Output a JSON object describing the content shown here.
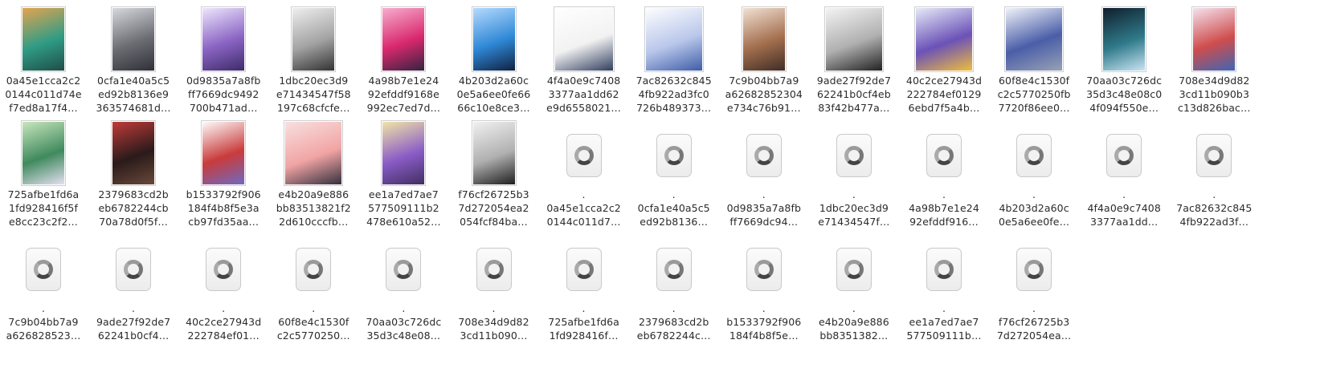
{
  "files": [
    {
      "kind": "image",
      "label": "0a45e1cca2c2\n0144c011d74e\nf7ed8a17f4…",
      "colors": [
        "#e8a44e",
        "#2f9c85",
        "#1f4a46"
      ]
    },
    {
      "kind": "image",
      "label": "0cfa1e40a5c5\ned92b8136e9\n363574681d…",
      "colors": [
        "#d8dbe0",
        "#6c6c73",
        "#2e2e36"
      ]
    },
    {
      "kind": "image",
      "label": "0d9835a7a8fb\nff7669dc9492\n700b471ad…",
      "colors": [
        "#efe9ff",
        "#8b64c4",
        "#3a2a66"
      ]
    },
    {
      "kind": "image",
      "label": "1dbc20ec3d9\ne71434547f58\n197c68cfcfe…",
      "colors": [
        "#f0f0f0",
        "#a3a3a3",
        "#2f2f2f"
      ]
    },
    {
      "kind": "image",
      "label": "4a98b7e1e24\n92efddf9168e\n992ec7ed7d…",
      "colors": [
        "#f7b1d1",
        "#d9286d",
        "#2f2340"
      ]
    },
    {
      "kind": "image",
      "label": "4b203d2a60c\n0e5a6ee0fe66\n66c10e8ce3…",
      "colors": [
        "#b9dcff",
        "#2f88d6",
        "#0e1e3c"
      ]
    },
    {
      "kind": "image-square",
      "label": "4f4a0e9c7408\n3377aa1dd62\ne9d6558021…",
      "colors": [
        "#ffffff",
        "#f2f2f2",
        "#2b3a5b"
      ]
    },
    {
      "kind": "image-wide",
      "label": "7ac82632c845\n4fb922ad3fc0\n726b489373…",
      "colors": [
        "#ffffff",
        "#b9c7ea",
        "#3b5aa6"
      ]
    },
    {
      "kind": "image",
      "label": "7c9b04bb7a9\na62682852304\ne734c76b91…",
      "colors": [
        "#f3e4d7",
        "#a46f4e",
        "#3d2b25"
      ]
    },
    {
      "kind": "image-wide",
      "label": "9ade27f92de7\n62241b0cf4eb\n83f42b477a…",
      "colors": [
        "#f5f5f5",
        "#b0b0b0",
        "#1e1e1e"
      ]
    },
    {
      "kind": "image-wide",
      "label": "40c2ce27943d\n222784ef0129\n6ebd7f5a4b…",
      "colors": [
        "#e8eef9",
        "#6b52b8",
        "#f2c03b"
      ]
    },
    {
      "kind": "image-wide",
      "label": "60f8e4c1530f\nc2c5770250fb\n7720f86ee0…",
      "colors": [
        "#f4f6fb",
        "#4a5ea8",
        "#9aa3b6"
      ]
    },
    {
      "kind": "image",
      "label": "70aa03c726dc\n35d3c48e08c0\n4f094f550e…",
      "colors": [
        "#0f1c2a",
        "#2f7a8a",
        "#cfe7f6"
      ]
    },
    {
      "kind": "image",
      "label": "708e34d9d82\n3cd11b090b3\nc13d826bac…",
      "colors": [
        "#f5e6f2",
        "#cf4d4d",
        "#3a66b6"
      ]
    },
    {
      "kind": "image",
      "label": "725afbe1fd6a\n1fd928416f5f\ne8cc23c2f2…",
      "colors": [
        "#cbe8bf",
        "#3f8a5d",
        "#e9e2f6"
      ]
    },
    {
      "kind": "image",
      "label": "2379683cd2b\neb6782244cb\n70a78d0f5f…",
      "colors": [
        "#c43b3b",
        "#2a1a1a",
        "#6a4a3a"
      ]
    },
    {
      "kind": "image",
      "label": "b1533792f906\n184f4b8f5e3a\ncb97fd35aa…",
      "colors": [
        "#ffffff",
        "#c93b3b",
        "#6b6bc6"
      ]
    },
    {
      "kind": "image-wide",
      "label": "e4b20a9e886\nbb83513821f2\n2d610cccfb…",
      "colors": [
        "#f8e1e1",
        "#f2a4a4",
        "#2d2d3b"
      ]
    },
    {
      "kind": "image",
      "label": "ee1a7ed7ae7\n577509111b2\n478e610a52…",
      "colors": [
        "#f3e8a6",
        "#8a5cc7",
        "#3e2e5e"
      ]
    },
    {
      "kind": "image",
      "label": "f76cf26725b3\n7d272054ea2\n054fcf84ba…",
      "colors": [
        "#f2f2f2",
        "#b0b0b0",
        "#1a1a1a"
      ]
    },
    {
      "kind": "json",
      "label": ".\n0a45e1cca2c2\n0144c011d7…"
    },
    {
      "kind": "json",
      "label": ".\n0cfa1e40a5c5\ned92b8136…"
    },
    {
      "kind": "json",
      "label": ".\n0d9835a7a8fb\nff7669dc94…"
    },
    {
      "kind": "json",
      "label": ".\n1dbc20ec3d9\ne71434547f…"
    },
    {
      "kind": "json",
      "label": ".\n4a98b7e1e24\n92efddf916…"
    },
    {
      "kind": "json",
      "label": ".\n4b203d2a60c\n0e5a6ee0fe…"
    },
    {
      "kind": "json",
      "label": ".\n4f4a0e9c7408\n3377aa1dd…"
    },
    {
      "kind": "json",
      "label": ".\n7ac82632c845\n4fb922ad3f…"
    },
    {
      "kind": "json",
      "label": ".\n7c9b04bb7a9\na626828523…"
    },
    {
      "kind": "json",
      "label": ".\n9ade27f92de7\n62241b0cf4…"
    },
    {
      "kind": "json",
      "label": ".\n40c2ce27943d\n222784ef01…"
    },
    {
      "kind": "json",
      "label": ".\n60f8e4c1530f\nc2c5770250…"
    },
    {
      "kind": "json",
      "label": ".\n70aa03c726dc\n35d3c48e08…"
    },
    {
      "kind": "json",
      "label": ".\n708e34d9d82\n3cd11b090…"
    },
    {
      "kind": "json",
      "label": ".\n725afbe1fd6a\n1fd928416f…"
    },
    {
      "kind": "json",
      "label": ".\n2379683cd2b\neb6782244c…"
    },
    {
      "kind": "json",
      "label": ".\nb1533792f906\n184f4b8f5e…"
    },
    {
      "kind": "json",
      "label": ".\ne4b20a9e886\nbb8351382…"
    },
    {
      "kind": "json",
      "label": ".\nee1a7ed7ae7\n577509111b…"
    },
    {
      "kind": "json",
      "label": ".\nf76cf26725b3\n7d272054ea…"
    }
  ]
}
